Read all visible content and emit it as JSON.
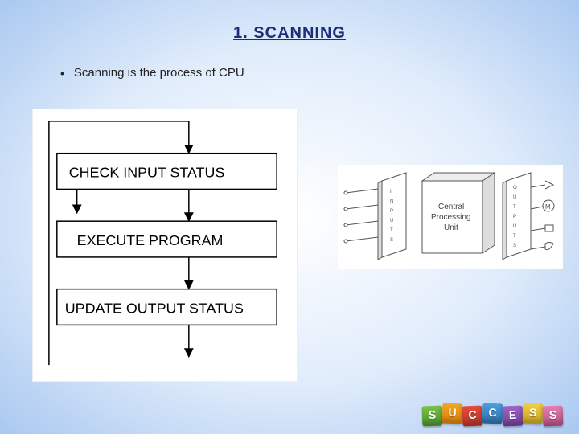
{
  "title": "1. SCANNING",
  "bullet": "Scanning is the process of CPU",
  "flowchart": {
    "step1": "CHECK INPUT STATUS",
    "step2": "EXECUTE PROGRAM",
    "step3": "UPDATE OUTPUT STATUS"
  },
  "plc": {
    "inputs_label": "INPUTS",
    "cpu_label_line1": "Central",
    "cpu_label_line2": "Processing",
    "cpu_label_line3": "Unit",
    "outputs_label": "OUTPUTS",
    "motor_label": "M"
  },
  "success": {
    "letters": [
      "S",
      "U",
      "C",
      "C",
      "E",
      "S",
      "S"
    ],
    "colors": [
      "b-green",
      "b-orange",
      "b-red",
      "b-blue",
      "b-purple",
      "b-yellow",
      "b-pink"
    ]
  }
}
